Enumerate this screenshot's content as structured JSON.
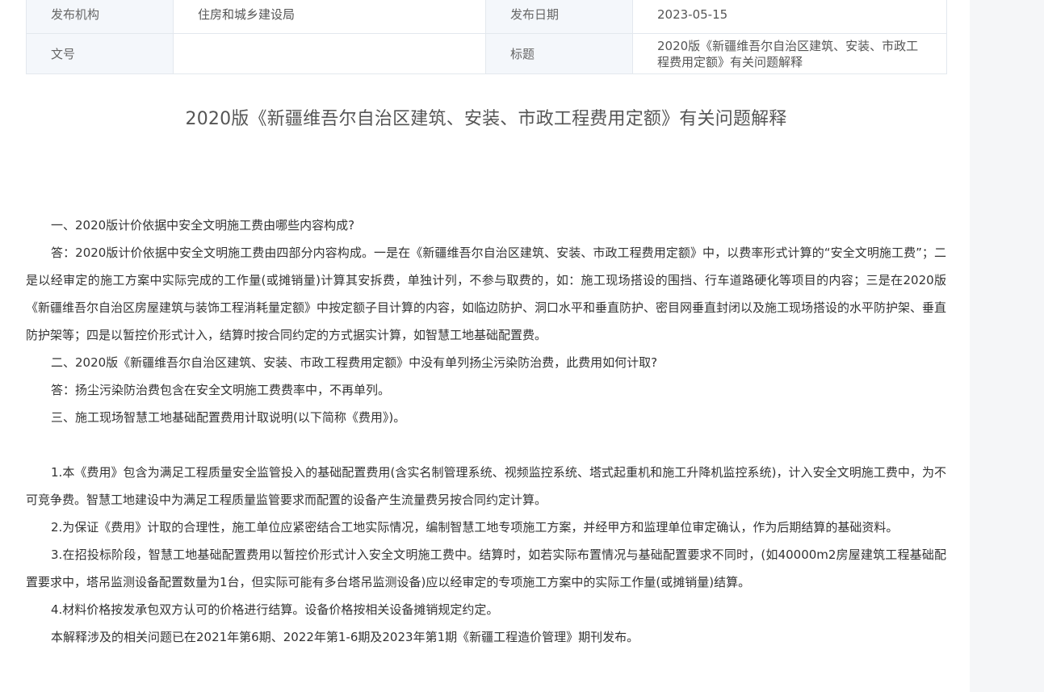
{
  "meta": {
    "publisher_label": "发布机构",
    "publisher_value": "住房和城乡建设局",
    "date_label": "发布日期",
    "date_value": "2023-05-15",
    "doc_no_label": "文号",
    "doc_no_value": "",
    "title_label": "标题",
    "title_value": "2020版《新疆维吾尔自治区建筑、安装、市政工程费用定额》有关问题解释"
  },
  "document": {
    "title": "2020版《新疆维吾尔自治区建筑、安装、市政工程费用定额》有关问题解释",
    "paragraphs": [
      "一、2020版计价依据中安全文明施工费由哪些内容构成?",
      "答：2020版计价依据中安全文明施工费由四部分内容构成。一是在《新疆维吾尔自治区建筑、安装、市政工程费用定额》中，以费率形式计算的“安全文明施工费”；二是以经审定的施工方案中实际完成的工作量(或摊销量)计算其安拆费，单独计列，不参与取费的，如：施工现场搭设的围挡、行车道路硬化等项目的内容；三是在2020版《新疆维吾尔自治区房屋建筑与装饰工程消耗量定额》中按定额子目计算的内容，如临边防护、洞口水平和垂直防护、密目网垂直封闭以及施工现场搭设的水平防护架、垂直防护架等；四是以暂控价形式计入，结算时按合同约定的方式据实计算，如智慧工地基础配置费。",
      "二、2020版《新疆维吾尔自治区建筑、安装、市政工程费用定额》中没有单列扬尘污染防治费，此费用如何计取?",
      "答：扬尘污染防治费包含在安全文明施工费费率中，不再单列。",
      "三、施工现场智慧工地基础配置费用计取说明(以下简称《费用》)。",
      "1.本《费用》包含为满足工程质量安全监管投入的基础配置费用(含实名制管理系统、视频监控系统、塔式起重机和施工升降机监控系统)，计入安全文明施工费中，为不可竞争费。智慧工地建设中为满足工程质量监管要求而配置的设备产生流量费另按合同约定计算。",
      "2.为保证《费用》计取的合理性，施工单位应紧密结合工地实际情况，编制智慧工地专项施工方案，并经甲方和监理单位审定确认，作为后期结算的基础资料。",
      "3.在招投标阶段，智慧工地基础配置费用以暂控价形式计入安全文明施工费中。结算时，如若实际布置情况与基础配置要求不同时，(如40000m2房屋建筑工程基础配置要求中，塔吊监测设备配置数量为1台，但实际可能有多台塔吊监测设备)应以经审定的专项施工方案中的实际工作量(或摊销量)结算。",
      "4.材料价格按发承包双方认可的价格进行结算。设备价格按相关设备摊销规定约定。",
      "本解释涉及的相关问题已在2021年第6期、2022年第1-6期及2023年第1期《新疆工程造价管理》期刊发布。"
    ]
  }
}
